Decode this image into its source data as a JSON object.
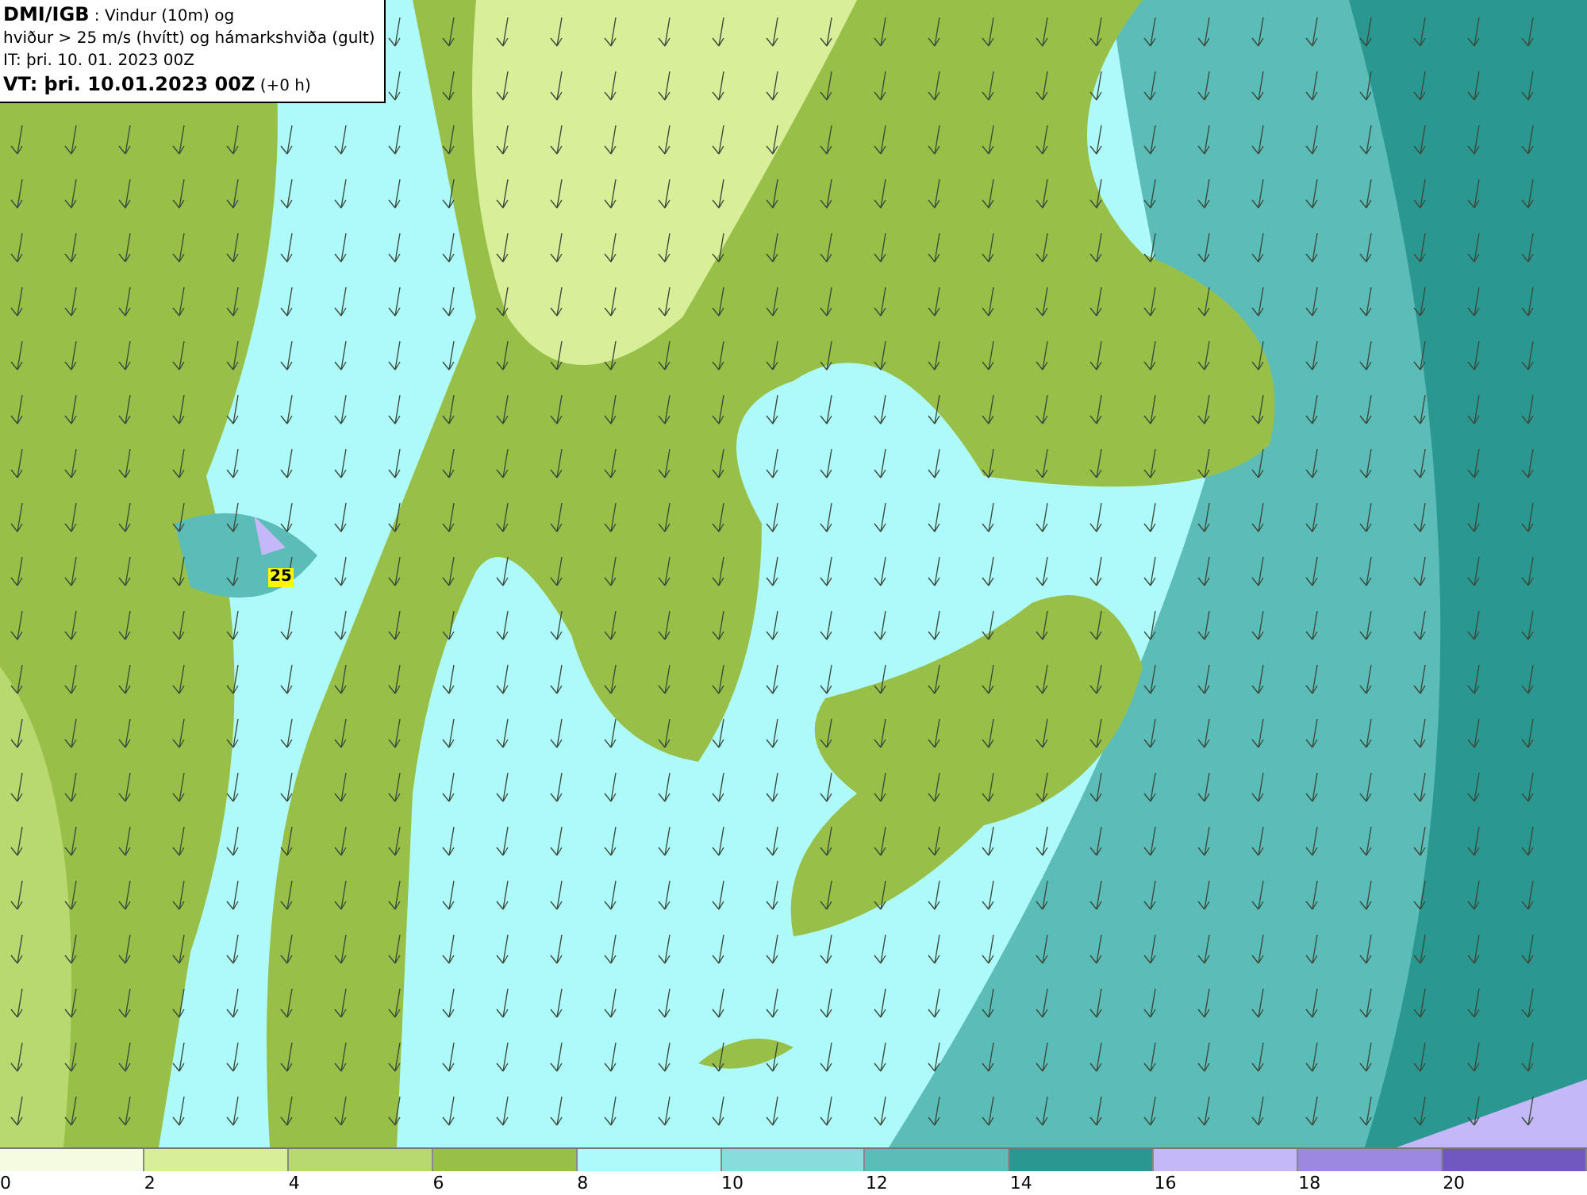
{
  "header": {
    "lines": [
      "**DMI/IGB** : Vindur (10m) og",
      "hviður > 25 m/s (hvítt) og hámarkshviða (gult)",
      "IT: þri. 10. 01. 2023 00Z",
      "**VT: þri. 10.01.2023 00Z** (+0 h)"
    ]
  },
  "map": {
    "gust_label": "25"
  },
  "legend": {
    "segments": [
      {
        "color": "#f5fbe0",
        "tick": "0"
      },
      {
        "color": "#d8ee98",
        "tick": "2"
      },
      {
        "color": "#b8d870",
        "tick": "4"
      },
      {
        "color": "#98c048",
        "tick": "6"
      },
      {
        "color": "#aefafa",
        "tick": "8"
      },
      {
        "color": "#88dcdc",
        "tick": "10"
      },
      {
        "color": "#5cbcb8",
        "tick": "12"
      },
      {
        "color": "#2a9890",
        "tick": "14"
      },
      {
        "color": "#c4b8f8",
        "tick": "16"
      },
      {
        "color": "#9c88e0",
        "tick": "18"
      },
      {
        "color": "#7058c0",
        "tick": "20"
      }
    ]
  }
}
